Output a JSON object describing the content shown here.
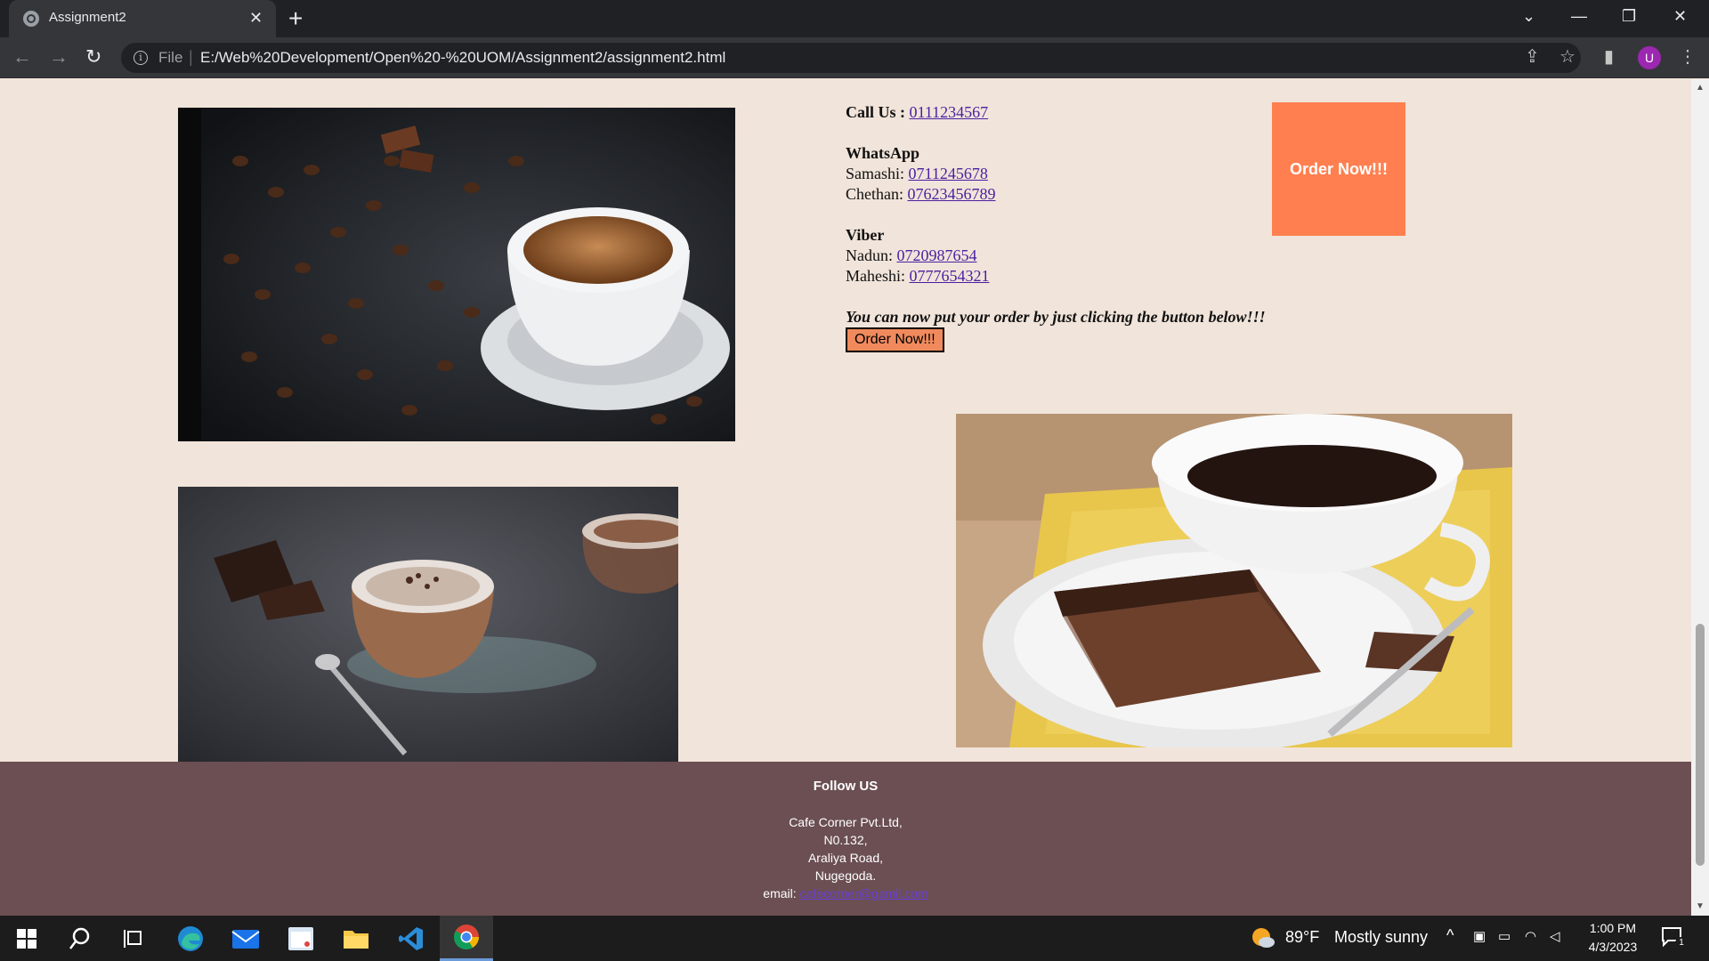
{
  "browser": {
    "tab_title": "Assignment2",
    "tab_close": "✕",
    "new_tab": "+",
    "scheme": "File",
    "url": "E:/Web%20Development/Open%20-%20UOM/Assignment2/assignment2.html",
    "profile_initial": "U"
  },
  "contact": {
    "call_label": "Call Us :",
    "call_number": "0111234567",
    "whatsapp_heading": "WhatsApp",
    "whatsapp": [
      {
        "name": "Samashi:",
        "number": "0711245678"
      },
      {
        "name": "Chethan:",
        "number": "07623456789"
      }
    ],
    "viber_heading": "Viber",
    "viber": [
      {
        "name": "Nadun:",
        "number": "0720987654"
      },
      {
        "name": "Maheshi:",
        "number": "0777654321"
      }
    ],
    "promo": "You can now put your order by just clicking the button below!!!",
    "order_button_small": "Order Now!!!"
  },
  "order_button_big": "Order Now!!!",
  "footer": {
    "follow": "Follow US",
    "address": [
      "Cafe Corner Pvt.Ltd,",
      "N0.132,",
      "Araliya Road,",
      "Nugegoda."
    ],
    "email_label": "email:",
    "email": "cafecorner@gamil.com"
  },
  "taskbar": {
    "weather_temp": "89°F",
    "weather_desc": "Mostly sunny",
    "time": "1:00 PM",
    "date": "4/3/2023",
    "notification_count": "1"
  },
  "colors": {
    "page_bg": "#f1e4da",
    "order_button": "#ff7f50",
    "footer_bg": "#6b4f53",
    "link": "#4b1fa0"
  }
}
